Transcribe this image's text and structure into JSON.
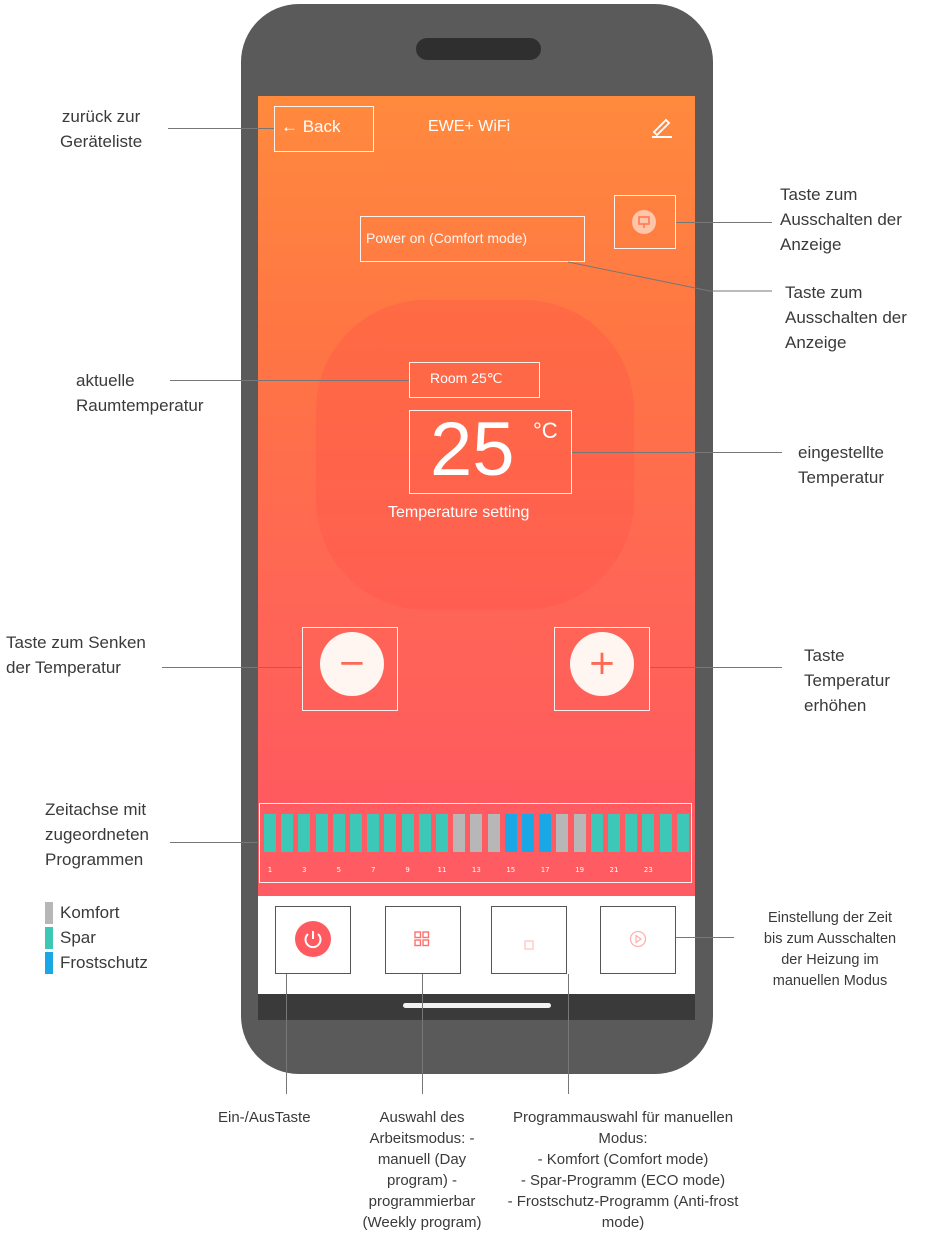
{
  "app": {
    "back_label": "← Back",
    "title": "EWE+ WiFi",
    "edit_icon": "pencil-icon",
    "display_off_icon": "display-off-icon",
    "status": "Power on (Comfort mode)",
    "room_temp": "Room 25℃",
    "set_temp": "25",
    "set_unit": "°C",
    "temp_setting_label": "Temperature setting",
    "minus_label": "−",
    "plus_label": "+"
  },
  "timeline": {
    "hour_labels": [
      "1",
      "3",
      "5",
      "7",
      "9",
      "11",
      "13",
      "15",
      "17",
      "19",
      "21",
      "23"
    ],
    "programs": [
      "spar",
      "spar",
      "spar",
      "spar",
      "spar",
      "spar",
      "spar",
      "spar",
      "spar",
      "spar",
      "spar",
      "komfort",
      "komfort",
      "komfort",
      "frost",
      "frost",
      "frost",
      "komfort",
      "komfort",
      "spar",
      "spar",
      "spar",
      "spar",
      "spar",
      "spar"
    ]
  },
  "colors": {
    "komfort": "#b7b7b7",
    "spar": "#3cc7b7",
    "frost": "#1aa7e6",
    "accent": "#ff5a5f"
  },
  "bottom_bar": {
    "power_icon": "power-icon",
    "mode_icon": "grid-icon",
    "program_icon": "program-icon",
    "timer_icon": "play-circle-icon"
  },
  "annotations": {
    "back": "zurück zur\nGeräteliste",
    "display_off": "Taste zum\nAusschalten der\nAnzeige",
    "status": "Taste zum\nAusschalten der\nAnzeige",
    "room_temp": "aktuelle\nRaumtemperatur",
    "set_temp": "eingestellte\nTemperatur",
    "minus": "Taste zum Senken\nder Temperatur",
    "plus": "Taste\nTemperatur\nerhöhen",
    "timeline": "Zeitachse mit\nzugeordneten\nProgrammen",
    "timer": "Einstellung der Zeit\nbis zum Ausschalten\nder Heizung im\nmanuellen Modus",
    "power": "Ein-/AusTaste",
    "mode": "Auswahl des\nArbeitsmodus: -\nmanuell (Day\nprogram) -\nprogrammierbar\n(Weekly program)",
    "program": "Programmauswahl für manuellen\nModus:\n- Komfort (Comfort mode)\n- Spar-Programm (ECO mode)\n- Frostschutz-Programm (Anti-frost\nmode)"
  },
  "legend": [
    {
      "label": "Komfort",
      "color": "#b7b7b7"
    },
    {
      "label": "Spar",
      "color": "#3cc7b7"
    },
    {
      "label": "Frostschutz",
      "color": "#1aa7e6"
    }
  ]
}
